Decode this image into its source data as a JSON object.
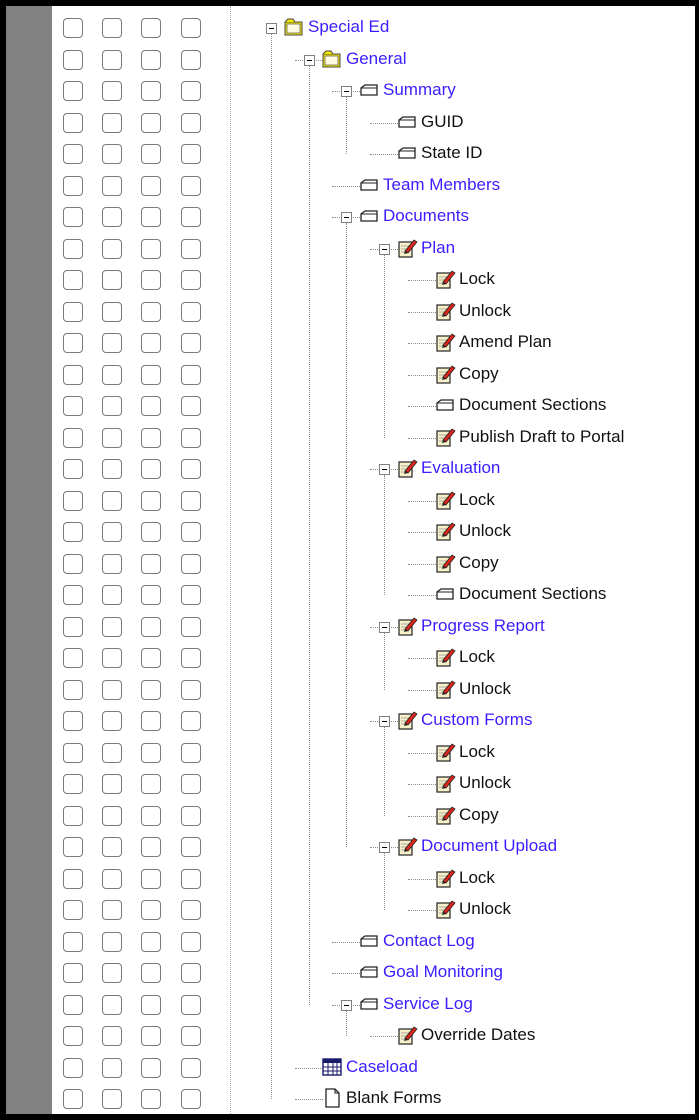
{
  "tree": [
    {
      "label": "Special Ed",
      "icon": "folder-open-icon",
      "level": 0,
      "toggle": true,
      "link": true
    },
    {
      "label": "General",
      "icon": "folder-open-icon",
      "level": 1,
      "toggle": true,
      "link": true
    },
    {
      "label": "Summary",
      "icon": "tab-icon",
      "level": 2,
      "toggle": true,
      "link": true
    },
    {
      "label": "GUID",
      "icon": "tab-icon",
      "level": 3,
      "toggle": false,
      "link": false
    },
    {
      "label": "State ID",
      "icon": "tab-icon",
      "level": 3,
      "toggle": false,
      "link": false
    },
    {
      "label": "Team Members",
      "icon": "tab-icon",
      "level": 2,
      "toggle": false,
      "link": true
    },
    {
      "label": "Documents",
      "icon": "tab-icon",
      "level": 2,
      "toggle": true,
      "link": true
    },
    {
      "label": "Plan",
      "icon": "edit-doc-icon",
      "level": 3,
      "toggle": true,
      "link": true
    },
    {
      "label": "Lock",
      "icon": "edit-doc-icon",
      "level": 4,
      "toggle": false,
      "link": false
    },
    {
      "label": "Unlock",
      "icon": "edit-doc-icon",
      "level": 4,
      "toggle": false,
      "link": false
    },
    {
      "label": "Amend Plan",
      "icon": "edit-doc-icon",
      "level": 4,
      "toggle": false,
      "link": false
    },
    {
      "label": "Copy",
      "icon": "edit-doc-icon",
      "level": 4,
      "toggle": false,
      "link": false
    },
    {
      "label": "Document Sections",
      "icon": "tab-icon",
      "level": 4,
      "toggle": false,
      "link": false
    },
    {
      "label": "Publish Draft to Portal",
      "icon": "edit-doc-icon",
      "level": 4,
      "toggle": false,
      "link": false
    },
    {
      "label": "Evaluation",
      "icon": "edit-doc-icon",
      "level": 3,
      "toggle": true,
      "link": true
    },
    {
      "label": "Lock",
      "icon": "edit-doc-icon",
      "level": 4,
      "toggle": false,
      "link": false
    },
    {
      "label": "Unlock",
      "icon": "edit-doc-icon",
      "level": 4,
      "toggle": false,
      "link": false
    },
    {
      "label": "Copy",
      "icon": "edit-doc-icon",
      "level": 4,
      "toggle": false,
      "link": false
    },
    {
      "label": "Document Sections",
      "icon": "tab-icon",
      "level": 4,
      "toggle": false,
      "link": false
    },
    {
      "label": "Progress Report",
      "icon": "edit-doc-icon",
      "level": 3,
      "toggle": true,
      "link": true
    },
    {
      "label": "Lock",
      "icon": "edit-doc-icon",
      "level": 4,
      "toggle": false,
      "link": false
    },
    {
      "label": "Unlock",
      "icon": "edit-doc-icon",
      "level": 4,
      "toggle": false,
      "link": false
    },
    {
      "label": "Custom Forms",
      "icon": "edit-doc-icon",
      "level": 3,
      "toggle": true,
      "link": true
    },
    {
      "label": "Lock",
      "icon": "edit-doc-icon",
      "level": 4,
      "toggle": false,
      "link": false
    },
    {
      "label": "Unlock",
      "icon": "edit-doc-icon",
      "level": 4,
      "toggle": false,
      "link": false
    },
    {
      "label": "Copy",
      "icon": "edit-doc-icon",
      "level": 4,
      "toggle": false,
      "link": false
    },
    {
      "label": "Document Upload",
      "icon": "edit-doc-icon",
      "level": 3,
      "toggle": true,
      "link": true
    },
    {
      "label": "Lock",
      "icon": "edit-doc-icon",
      "level": 4,
      "toggle": false,
      "link": false
    },
    {
      "label": "Unlock",
      "icon": "edit-doc-icon",
      "level": 4,
      "toggle": false,
      "link": false
    },
    {
      "label": "Contact Log",
      "icon": "tab-icon",
      "level": 2,
      "toggle": false,
      "link": true
    },
    {
      "label": "Goal Monitoring",
      "icon": "tab-icon",
      "level": 2,
      "toggle": false,
      "link": true
    },
    {
      "label": "Service Log",
      "icon": "tab-icon",
      "level": 2,
      "toggle": true,
      "link": true
    },
    {
      "label": "Override Dates",
      "icon": "edit-doc-icon",
      "level": 3,
      "toggle": false,
      "link": false
    },
    {
      "label": "Caseload",
      "icon": "grid-icon",
      "level": 1,
      "toggle": false,
      "link": true
    },
    {
      "label": "Blank Forms",
      "icon": "document-icon",
      "level": 1,
      "toggle": false,
      "link": false
    }
  ],
  "checkbox_columns": 4,
  "colors": {
    "link": "#3b1dff",
    "text": "#111111",
    "sidebar": "#818181",
    "folder": "#f3e600"
  }
}
